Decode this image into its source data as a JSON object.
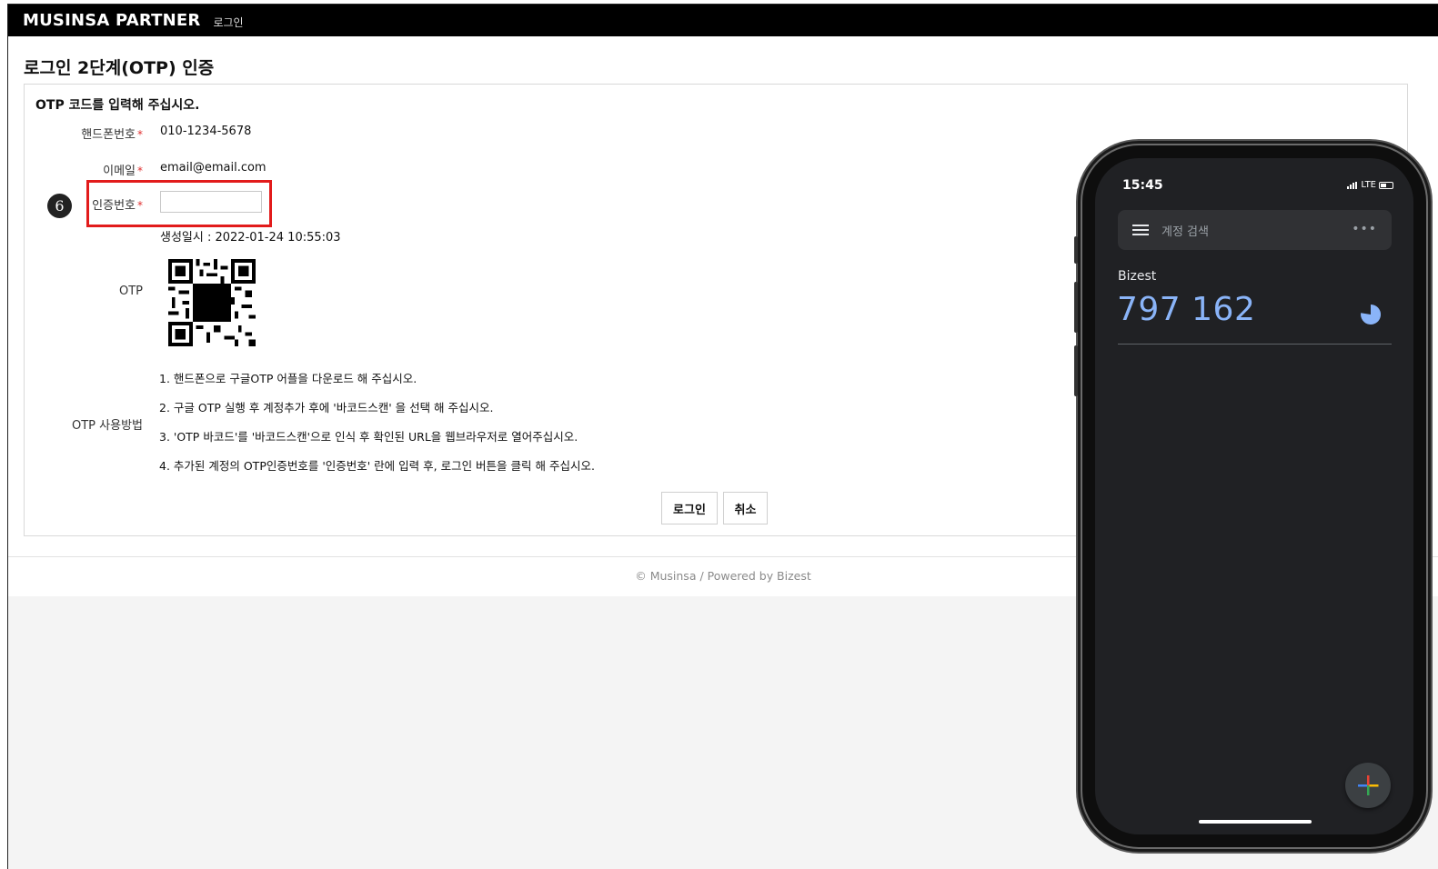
{
  "header": {
    "brand": "MUSINSA PARTNER",
    "sub": "로그인"
  },
  "page": {
    "title": "로그인 2단계(OTP) 인증"
  },
  "form": {
    "heading": "OTP 코드를 입력해 주십시오.",
    "required_mark": "*",
    "phone_label": "핸드폰번호",
    "phone_value": "010-1234-5678",
    "email_label": "이메일",
    "email_value": "email@email.com",
    "code_label": "인증번호",
    "code_value": "",
    "created_text": "생성일시 : 2022-01-24 10:55:03",
    "otp_label": "OTP",
    "usage_label": "OTP 사용방법",
    "steps": [
      "1. 핸드폰으로 구글OTP 어플을 다운로드 해 주십시오.",
      "2. 구글 OTP 실행 후 계정추가 후에 '바코드스캔' 을 선택 해 주십시오.",
      "3. 'OTP 바코드'를 '바코드스캔'으로 인식 후 확인된 URL을 웹브라우저로 열어주십시오.",
      "4. 추가된 계정의 OTP인증번호를 '인증번호' 란에 입력 후, 로그인 버튼을 클릭 해 주십시오."
    ],
    "login_button": "로그인",
    "cancel_button": "취소"
  },
  "annotation": {
    "step_number": "6"
  },
  "footer": {
    "text": "© Musinsa / Powered by Bizest"
  },
  "phone": {
    "time": "15:45",
    "network": "LTE",
    "search_placeholder": "계정 검색",
    "more": "•••",
    "account_name": "Bizest",
    "otp_code": "797 162",
    "icons": [
      "menu-icon",
      "more-icon",
      "timer-icon",
      "add-icon"
    ]
  },
  "colors": {
    "header_bg": "#000000",
    "highlight": "#e21b1b",
    "required": "#e03030",
    "otp_code": "#8ab4f8",
    "phone_bg": "#202124"
  }
}
